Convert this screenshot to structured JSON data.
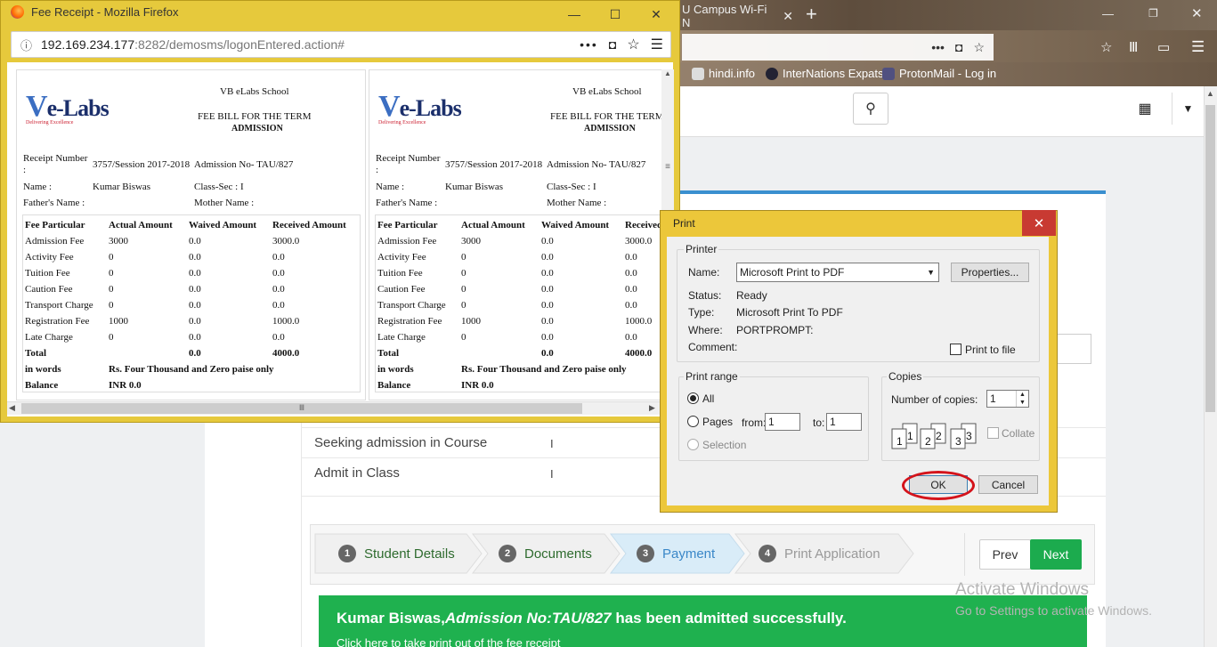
{
  "background_browser": {
    "tab_label": "U Campus Wi-Fi N",
    "bookmarks": [
      "hindi.info",
      "InterNations Expats",
      "ProtonMail - Log in"
    ]
  },
  "form": {
    "fields": [
      {
        "label": "Seeking admission in Course",
        "value": "I"
      },
      {
        "label": "Admit in Class",
        "value": "I"
      }
    ]
  },
  "wizard": {
    "steps": [
      {
        "num": "1",
        "label": "Student Details"
      },
      {
        "num": "2",
        "label": "Documents"
      },
      {
        "num": "3",
        "label": "Payment"
      },
      {
        "num": "4",
        "label": "Print Application"
      }
    ],
    "prev": "Prev",
    "next": "Next"
  },
  "success": {
    "name": "Kumar Biswas,",
    "admission": "Admission No:TAU/827",
    "rest": " has been admitted successfully.",
    "link": "Click here to take print out of the fee receipt"
  },
  "watermark": {
    "line1": "Activate Windows",
    "line2": "Go to Settings to activate Windows."
  },
  "receipt_window": {
    "title": "Fee Receipt - Mozilla Firefox",
    "url_host": "192.169.234.177",
    "url_rest": ":8282/demosms/logonEntered.action#"
  },
  "receipt": {
    "logo": "e-Labs",
    "logo_tag": "Delivering Excellence",
    "school": "VB eLabs School",
    "bill_title": "FEE BILL FOR THE TERM",
    "bill_sub": "ADMISSION",
    "receipt_label": "Receipt Number",
    "receipt_colon": ":",
    "receipt_no": "3757/Session 2017-2018",
    "admission_no": "Admission No- TAU/827",
    "name_label": "Name :",
    "name": "Kumar Biswas",
    "class_sec": "Class-Sec : I",
    "father_label": "Father's Name :",
    "mother_label": "Mother Name :",
    "headers": [
      "Fee Particular",
      "Actual Amount",
      "Waived Amount",
      "Received Amount"
    ],
    "rows": [
      [
        "Admission Fee",
        "3000",
        "0.0",
        "3000.0"
      ],
      [
        "Activity Fee",
        "0",
        "0.0",
        "0.0"
      ],
      [
        "Tuition Fee",
        "0",
        "0.0",
        "0.0"
      ],
      [
        "Caution Fee",
        "0",
        "0.0",
        "0.0"
      ],
      [
        "Transport Charge",
        "0",
        "0.0",
        "0.0"
      ],
      [
        "Registration Fee",
        "1000",
        "0.0",
        "1000.0"
      ],
      [
        "Late Charge",
        "0",
        "0.0",
        "0.0"
      ]
    ],
    "total": [
      "Total",
      "",
      "0.0",
      "4000.0"
    ],
    "in_words_label": "in words",
    "in_words": "Rs. Four Thousand and Zero paise only",
    "balance_label": "Balance",
    "balance": "INR 0.0"
  },
  "print_dialog": {
    "title": "Print",
    "printer_group": "Printer",
    "name_label": "Name:",
    "printer_name": "Microsoft Print to PDF",
    "properties": "Properties...",
    "status_label": "Status:",
    "status": "Ready",
    "type_label": "Type:",
    "type": "Microsoft Print To PDF",
    "where_label": "Where:",
    "where": "PORTPROMPT:",
    "comment_label": "Comment:",
    "print_to_file": "Print to file",
    "range_group": "Print range",
    "all": "All",
    "pages": "Pages",
    "from_label": "from:",
    "from": "1",
    "to_label": "to:",
    "to": "1",
    "selection": "Selection",
    "copies_group": "Copies",
    "copies_label": "Number of copies:",
    "copies": "1",
    "collate": "Collate",
    "ok": "OK",
    "cancel": "Cancel"
  }
}
